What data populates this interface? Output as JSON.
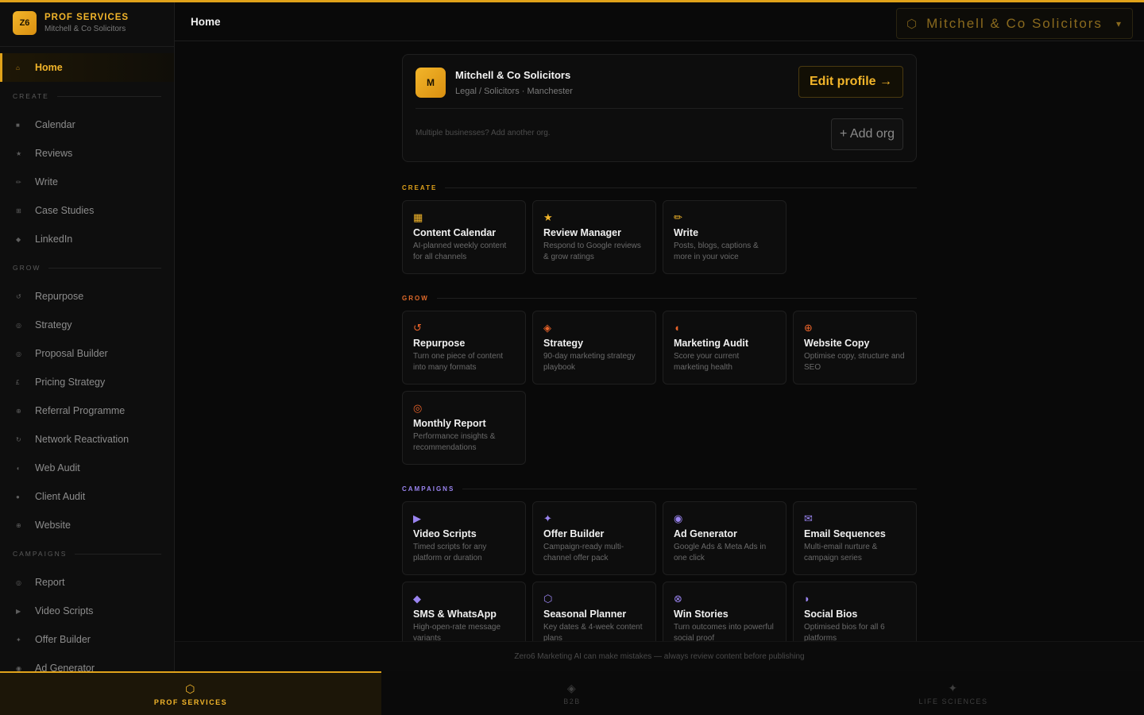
{
  "brand": {
    "logo": "Z6",
    "title": "PROF SERVICES",
    "subtitle": "Mitchell & Co Solicitors"
  },
  "sidebar": {
    "home": {
      "label": "Home",
      "icon": "home-icon",
      "glyph": "⌂"
    },
    "sections": [
      {
        "title": "CREATE",
        "items": [
          {
            "label": "Calendar",
            "glyph": "■"
          },
          {
            "label": "Reviews",
            "glyph": "★"
          },
          {
            "label": "Write",
            "glyph": "✏"
          },
          {
            "label": "Case Studies",
            "glyph": "⊞"
          },
          {
            "label": "LinkedIn",
            "glyph": "◆"
          }
        ]
      },
      {
        "title": "GROW",
        "items": [
          {
            "label": "Repurpose",
            "glyph": "↺"
          },
          {
            "label": "Strategy",
            "glyph": "◎"
          },
          {
            "label": "Proposal Builder",
            "glyph": "◎"
          },
          {
            "label": "Pricing Strategy",
            "glyph": "£"
          },
          {
            "label": "Referral Programme",
            "glyph": "⊕"
          },
          {
            "label": "Network Reactivation",
            "glyph": "↻"
          },
          {
            "label": "Web Audit",
            "glyph": "◖"
          },
          {
            "label": "Client Audit",
            "glyph": "●"
          },
          {
            "label": "Website",
            "glyph": "⊕"
          }
        ]
      },
      {
        "title": "CAMPAIGNS",
        "items": [
          {
            "label": "Report",
            "glyph": "◎"
          },
          {
            "label": "Video Scripts",
            "glyph": "▶"
          },
          {
            "label": "Offer Builder",
            "glyph": "✦"
          },
          {
            "label": "Ad Generator",
            "glyph": "◉"
          }
        ]
      }
    ]
  },
  "header": {
    "title": "Home",
    "org_switcher": "Mitchell & Co Solicitors",
    "caret": "▾",
    "hex": "⬡"
  },
  "profile": {
    "initial": "M",
    "name": "Mitchell & Co Solicitors",
    "meta": "Legal / Solicitors · Manchester",
    "edit_label": "Edit profile →",
    "multi_note": "Multiple businesses? Add another org.",
    "add_org_label": "+ Add org"
  },
  "sections": {
    "create": {
      "title": "CREATE",
      "tiles": [
        {
          "glyph": "▦",
          "title": "Content Calendar",
          "desc": "AI-planned weekly content for all channels"
        },
        {
          "glyph": "★",
          "title": "Review Manager",
          "desc": "Respond to Google reviews & grow ratings"
        },
        {
          "glyph": "✏",
          "title": "Write",
          "desc": "Posts, blogs, captions & more in your voice"
        }
      ]
    },
    "grow": {
      "title": "GROW",
      "tiles": [
        {
          "glyph": "↺",
          "title": "Repurpose",
          "desc": "Turn one piece of content into many formats"
        },
        {
          "glyph": "◈",
          "title": "Strategy",
          "desc": "90-day marketing strategy playbook"
        },
        {
          "glyph": "◖",
          "title": "Marketing Audit",
          "desc": "Score your current marketing health"
        },
        {
          "glyph": "⊕",
          "title": "Website Copy",
          "desc": "Optimise copy, structure and SEO"
        },
        {
          "glyph": "◎",
          "title": "Monthly Report",
          "desc": "Performance insights & recommendations"
        }
      ]
    },
    "campaigns": {
      "title": "CAMPAIGNS",
      "tiles": [
        {
          "glyph": "▶",
          "title": "Video Scripts",
          "desc": "Timed scripts for any platform or duration"
        },
        {
          "glyph": "✦",
          "title": "Offer Builder",
          "desc": "Campaign-ready multi-channel offer pack"
        },
        {
          "glyph": "◉",
          "title": "Ad Generator",
          "desc": "Google Ads & Meta Ads in one click"
        },
        {
          "glyph": "✉",
          "title": "Email Sequences",
          "desc": "Multi-email nurture & campaign series"
        },
        {
          "glyph": "◆",
          "title": "SMS & WhatsApp",
          "desc": "High-open-rate message variants"
        },
        {
          "glyph": "⬡",
          "title": "Seasonal Planner",
          "desc": "Key dates & 4-week content plans"
        },
        {
          "glyph": "⊗",
          "title": "Win Stories",
          "desc": "Turn outcomes into powerful social proof"
        },
        {
          "glyph": "◗",
          "title": "Social Bios",
          "desc": "Optimised bios for all 6 platforms"
        }
      ]
    }
  },
  "footer_note": "Zero6 Marketing AI can make mistakes — always review content before publishing",
  "bottom_tabs": [
    {
      "label": "PROF SERVICES",
      "glyph": "⬡",
      "active": true
    },
    {
      "label": "B2B",
      "glyph": "◈",
      "active": false
    },
    {
      "label": "LIFE SCIENCES",
      "glyph": "✦",
      "active": false
    }
  ],
  "colors": {
    "accent": "#e0a21a",
    "grow": "#e8632a",
    "campaigns": "#9a84f0",
    "background": "#090909"
  }
}
